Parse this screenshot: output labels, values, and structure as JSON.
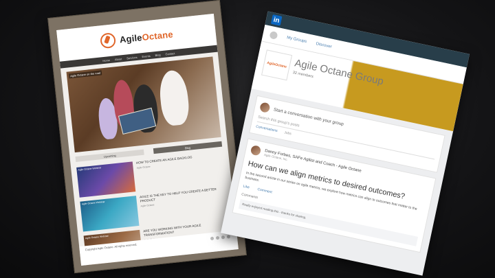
{
  "site": {
    "brand_prefix": "Agile",
    "brand_suffix": "Octane",
    "nav": [
      "Home",
      "About",
      "Services",
      "Events",
      "Blog",
      "Contact"
    ],
    "hero_caption": "Agile Octane on the road",
    "buttons": [
      "Upcoming",
      "Blog"
    ],
    "items": [
      {
        "thumb_label": "Agile Octane Webinar",
        "title": "How to create an agile backlog",
        "meta": "Agile Octane"
      },
      {
        "thumb_label": "Agile Octane Webinar",
        "title": "Agile is the key to help you create a better product",
        "meta": "Agile Octane"
      },
      {
        "thumb_label": "Agile Octane Webinar",
        "title": "Are you working with your agile transformation?",
        "meta": "Agile Octane"
      }
    ],
    "footer_text": "Copyright Agile Octane. All rights reserved."
  },
  "linkedin": {
    "logo": "in",
    "nav": [
      "My Groups",
      "Discover"
    ],
    "group_logo_text": "AgileOctane",
    "group_title": "Agile Octane Group",
    "group_members": "32 members",
    "share_prompt": "Start a conversation with your group",
    "search_placeholder": "Search this group's posts",
    "tabs": [
      "Conversations",
      "Jobs"
    ],
    "post_author": "Danny Forbes, SAFe Agilist and Coach - Agile Octane",
    "post_meta": "Agile Octane, Inc.",
    "post_question": "How can we align metrics to desired outcomes?",
    "post_body": "In the second article in our series on agile metrics, we explore how metrics can align to outcomes that matter to the business.",
    "actions": [
      "Like",
      "Comment"
    ],
    "comments_label": "Comments",
    "comment_text": "Really enjoyed reading this - thanks for sharing."
  }
}
